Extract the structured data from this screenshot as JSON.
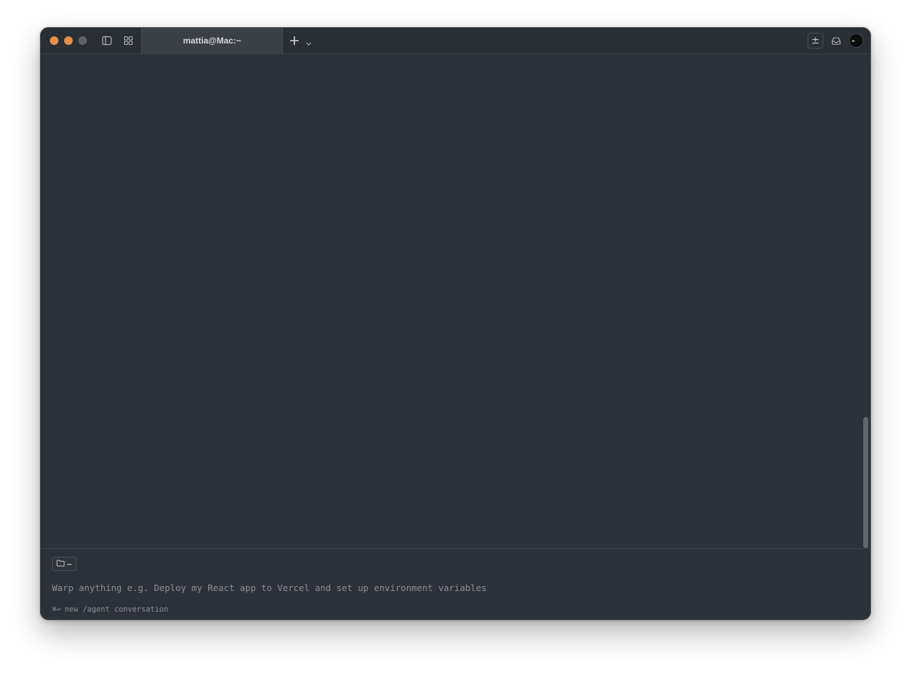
{
  "window": {
    "tab_title": "mattia@Mac:~"
  },
  "icons": {
    "close": "close-traffic-light",
    "minimize": "minimize-traffic-light",
    "maximize": "maximize-traffic-light",
    "sidebar": "sidebar-toggle-icon",
    "grid": "grid-icon",
    "new_tab": "plus-icon",
    "new_tab_menu": "chevron-down-icon",
    "plus_minus": "plus-minus-icon",
    "inbox": "inbox-icon",
    "avatar": "user-avatar"
  },
  "toolbar": {
    "plus_minus_label": "±"
  },
  "input": {
    "directory": "~",
    "placeholder": "Warp anything e.g. Deploy my React app to Vercel and set up environment variables",
    "hint_keys": "⌘↩",
    "hint_text": "new /agent conversation"
  },
  "colors": {
    "background": "#2d3139",
    "titlebar": "#2a2e35",
    "active_tab": "#3b3f46",
    "traffic_light": "#e6904a",
    "muted_text": "#8c8f94"
  }
}
